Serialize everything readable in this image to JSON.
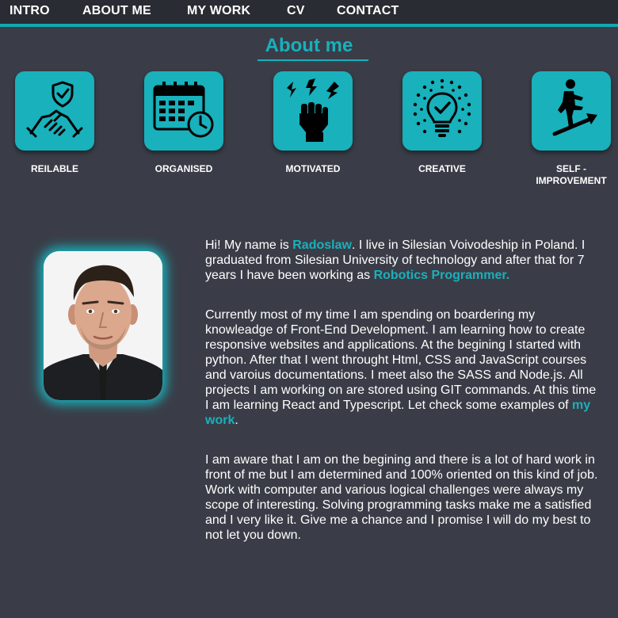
{
  "nav": {
    "items": [
      "INTRO",
      "ABOUT ME",
      "MY WORK",
      "CV",
      "CONTACT"
    ]
  },
  "about": {
    "title": "About me",
    "traits": [
      {
        "label": "REILABLE",
        "icon": "handshake-shield-icon"
      },
      {
        "label": "ORGANISED",
        "icon": "calendar-clock-icon"
      },
      {
        "label": "MOTIVATED",
        "icon": "raised-fist-icon"
      },
      {
        "label": "CREATIVE",
        "icon": "lightbulb-idea-icon"
      },
      {
        "label": "SELF - IMPROVEMENT",
        "icon": "climbing-stairs-icon"
      }
    ]
  },
  "bio": {
    "p1": {
      "a": "Hi! My name is ",
      "name": "Radoslaw",
      "b": ". I live in Silesian Voivodeship in Poland. I graduated from Silesian University of technology and after that for 7 years I have been working as ",
      "role": "Robotics Programmer."
    },
    "p2": {
      "a": "Currently most of my time I am spending on boardering my knowleadge of Front-End Development. I am learning how to create responsive websites and applications. At the begining I started with python. After that I went throught Html, CSS and JavaScript courses and varoius documentations. I meet also the SASS and Node.js. All projects I am working on are stored using GIT commands. At this time I am learning React and Typescript. Let check some examples of ",
      "link": "my work",
      "b": "."
    },
    "p3": {
      "a": "I am aware that I am on the begining and there is a lot of hard work in front of me but I am determined and 100% oriented on this kind of job.",
      "b": "Work with computer and various logical challenges were always my scope of interesting. Solving programming tasks make me a satisfied and I very like it. Give me a chance and I promise I will do my best to not let you down."
    }
  },
  "colors": {
    "accent": "#18b1bc",
    "background": "#3a3d47",
    "nav_background": "#2a2c33"
  }
}
